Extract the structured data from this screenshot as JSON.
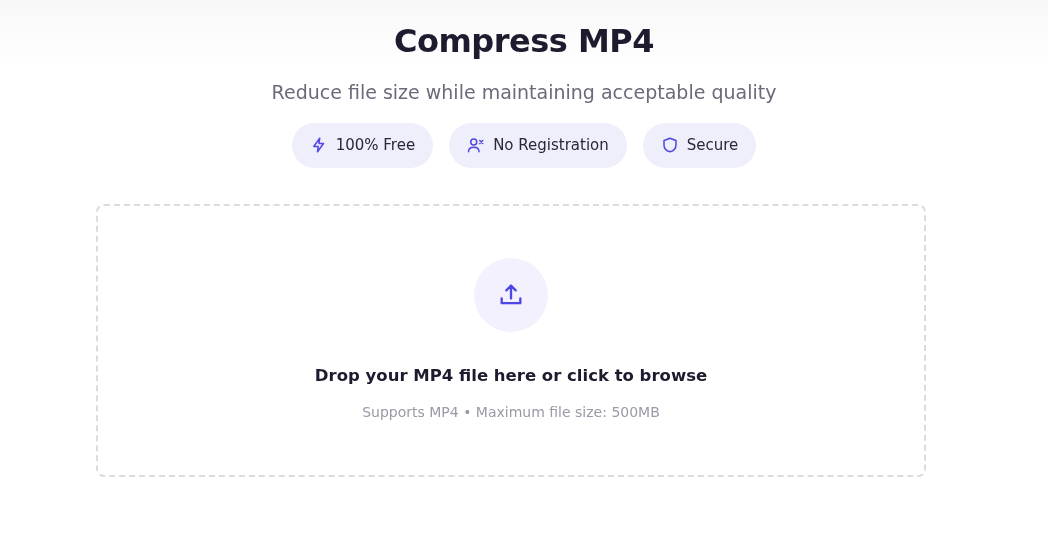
{
  "title": "Compress MP4",
  "subtitle": "Reduce file size while maintaining acceptable quality",
  "badges": [
    {
      "kind": "bolt",
      "label": "100% Free"
    },
    {
      "kind": "user-x",
      "label": "No Registration"
    },
    {
      "kind": "shield",
      "label": "Secure"
    }
  ],
  "dropzone": {
    "heading": "Drop your MP4 file here or click to browse",
    "note": "Supports MP4 • Maximum file size: 500MB"
  }
}
